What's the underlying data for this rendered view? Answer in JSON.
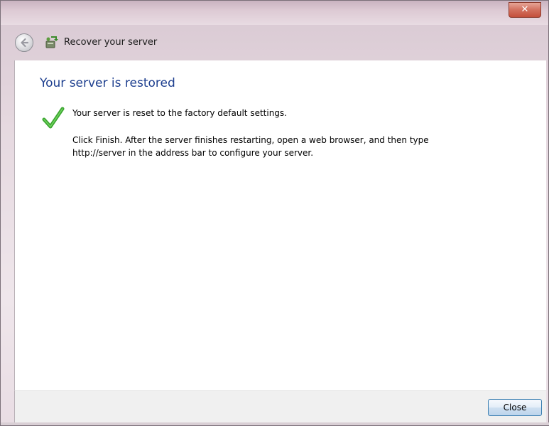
{
  "window": {
    "title_close_glyph": "✕"
  },
  "navbar": {
    "title": "Recover your server",
    "back_icon": "back-arrow-icon",
    "app_icon": "server-recovery-icon"
  },
  "content": {
    "heading": "Your server is restored",
    "status_icon": "checkmark-icon",
    "status_text": "Your server is reset to the factory default settings.",
    "instructions_line1": "Click Finish. After the server finishes restarting, open a web browser, and then type",
    "instructions_line2": "http://server in the address bar to configure your server."
  },
  "footer": {
    "close_label": "Close"
  },
  "colors": {
    "heading": "#1e3f8f",
    "check": "#3aa52f",
    "button_border": "#3c7fb1"
  }
}
